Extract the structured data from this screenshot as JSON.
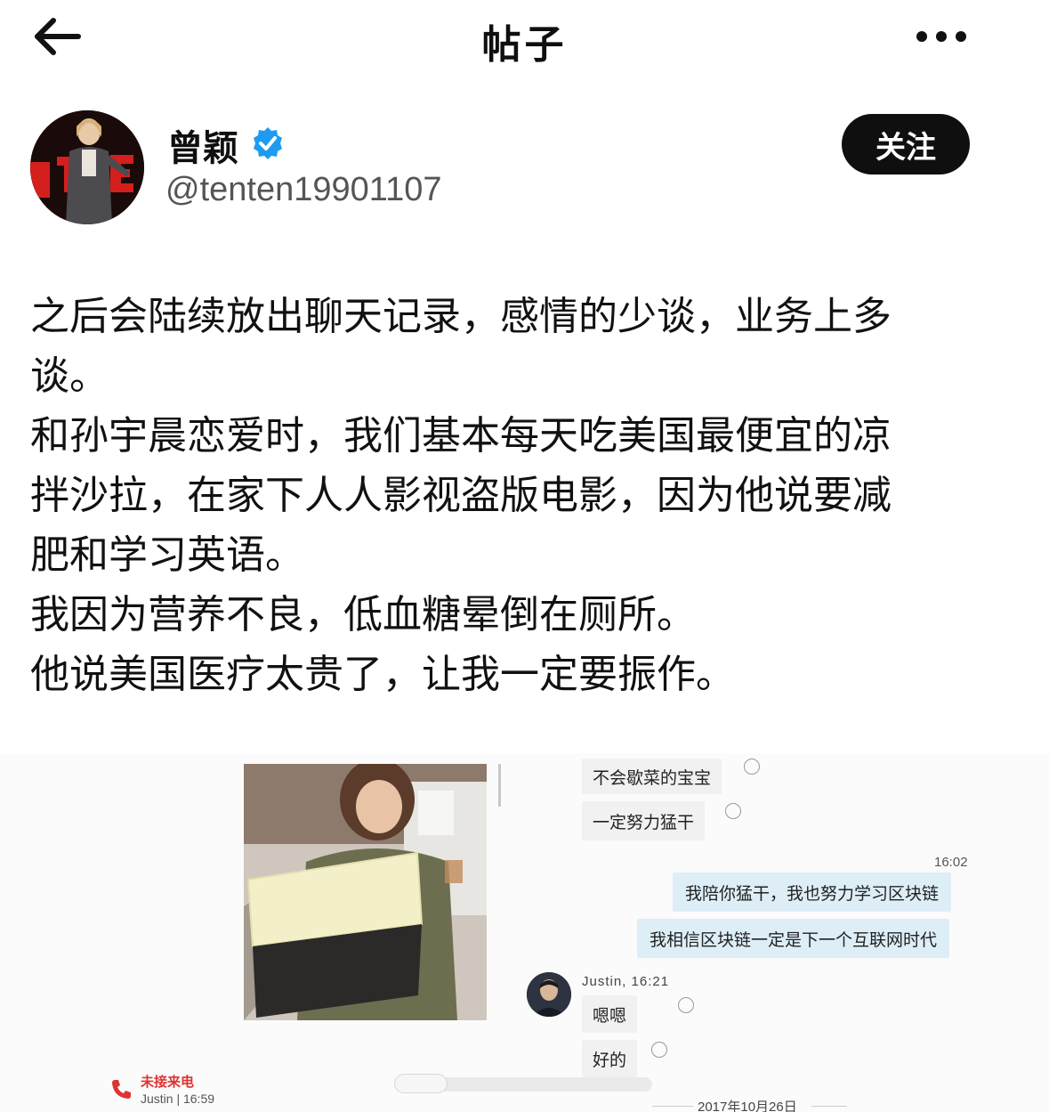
{
  "header": {
    "title": "帖子"
  },
  "author": {
    "name": "曾颖",
    "handle": "@tenten19901107",
    "follow_label": "关注",
    "verified": true
  },
  "post": {
    "lines": [
      "之后会陆续放出聊天记录，感情的少谈，业务上多",
      "谈。",
      "和孙宇晨恋爱时，我们基本每天吃美国最便宜的凉",
      "拌沙拉，在家下人人影视盗版电影，因为他说要减",
      "肥和学习英语。",
      "我因为营养不良，低血糖晕倒在厕所。",
      "他说美国医疗太贵了，让我一定要振作。"
    ]
  },
  "embed": {
    "messages_in_top": [
      "不会歇菜的宝宝",
      "一定努力猛干"
    ],
    "time_1": "16:02",
    "messages_out": [
      "我陪你猛干，我也努力学习区块链",
      "我相信区块链一定是下一个互联网时代"
    ],
    "sender": "Justin, 16:21",
    "messages_in_bottom": [
      "嗯嗯",
      "好的"
    ],
    "missed_call_label": "未接来电",
    "missed_call_meta": "Justin | 16:59",
    "date": "2017年10月26日"
  },
  "colors": {
    "follow_bg": "#0f0f0f",
    "verified": "#1d9bf0",
    "missed_call": "#dd3333",
    "outgoing_bubble": "#ddeef7"
  }
}
